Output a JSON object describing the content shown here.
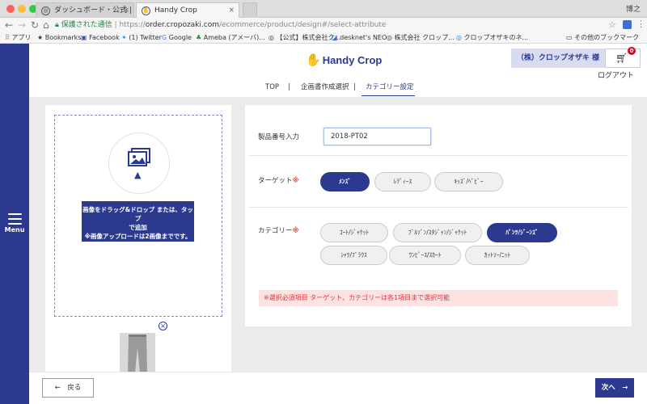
{
  "browser": {
    "tabs": [
      {
        "label": "ダッシュボード・公式 | 株式会社",
        "active": false
      },
      {
        "label": "Handy Crop",
        "active": true
      }
    ],
    "user_name": "博之",
    "address": {
      "secure_label": "保護された通信",
      "url_scheme": "https://",
      "url_domain": "order.cropozaki.com",
      "url_path": "/ecommerce/product/design#/select-attribute"
    },
    "bookmarks": [
      "アプリ",
      "Bookmarks",
      "Facebook",
      "(1) Twitter",
      "Google",
      "Ameba (アメーバ)...",
      "【公式】株式会社ク...",
      "desknet's NEO",
      "株式会社 クロップ...",
      "クロップオザキのネ...",
      "その他のブックマーク"
    ]
  },
  "sidebar": {
    "menu_label": "Menu"
  },
  "header": {
    "logo_text": "Handy Crop",
    "company_label": "（株）クロップオザキ 様",
    "cart_count": "0",
    "logout_label": "ログアウト",
    "nav": {
      "top": "TOP",
      "plan": "企画書作成選択",
      "category": "カテゴリー設定",
      "separator": "|"
    }
  },
  "upload": {
    "line1": "画像をドラッグ&ドロップ または、タップ",
    "line2": "で追加",
    "line3": "※画像アップロードは2画像までです。",
    "remove_icon": "×"
  },
  "form": {
    "product_number_label": "製品番号入力",
    "product_number_value": "2018-PT02",
    "target_label": "ターゲット",
    "category_label": "カテゴリー",
    "required_mark": "※",
    "target_options": [
      {
        "label": "ﾒﾝｽﾞ",
        "selected": true
      },
      {
        "label": "ﾚﾃﾞｨｰｽ",
        "selected": false
      },
      {
        "label": "ｷｯｽﾞ/ﾍﾞﾋﾞｰ",
        "selected": false
      }
    ],
    "category_options": [
      {
        "label": "ｺｰﾄ/ｼﾞｬｹｯﾄ",
        "selected": false
      },
      {
        "label": "ﾌﾞﾙｿﾞﾝ/ｽﾀｼﾞｬﾝ/ｼﾞｬｹｯﾄ",
        "selected": false
      },
      {
        "label": "ﾊﾟﾝﾂ/ｼﾞｰﾝｽﾞ",
        "selected": true
      },
      {
        "label": "ｼｬﾂ/ﾌﾞﾗｳｽ",
        "selected": false
      },
      {
        "label": "ﾜﾝﾋﾟｰｽ/ｽｶｰﾄ",
        "selected": false
      },
      {
        "label": "ｶｯﾄｿｰ/ﾆｯﾄ",
        "selected": false
      }
    ],
    "notice": "※選択必須項目 ターゲット、カテゴリーは各1項目まで選択可能"
  },
  "footer": {
    "back_label": "←　戻る",
    "next_label": "次へ　→"
  },
  "colors": {
    "brand": "#2b3a8f",
    "required": "#e05050",
    "notice_bg": "#fde2e2",
    "badge": "#e60012"
  }
}
